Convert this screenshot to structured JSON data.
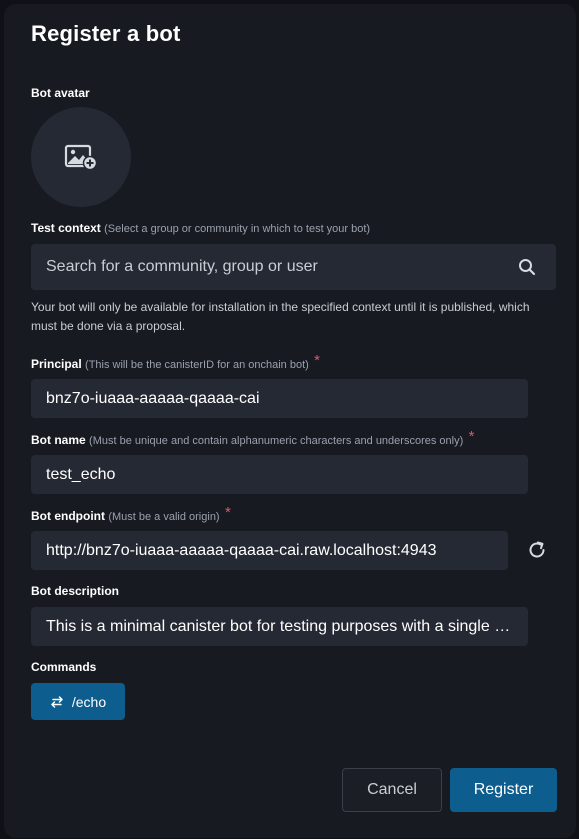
{
  "dialog": {
    "title": "Register a bot"
  },
  "avatar": {
    "label": "Bot avatar",
    "icon": "add-image-icon"
  },
  "test_context": {
    "label": "Test context",
    "hint": "(Select a group or community in which to test your bot)",
    "placeholder": "Search for a community, group or user",
    "icon": "search-icon",
    "note": "Your bot will only be available for installation in the specified context until it is published, which must be done via a proposal."
  },
  "principal": {
    "label": "Principal",
    "hint": "(This will be the canisterID for an onchain bot)",
    "required": "*",
    "value": "bnz7o-iuaaa-aaaaa-qaaaa-cai"
  },
  "bot_name": {
    "label": "Bot name",
    "hint": "(Must be unique and contain alphanumeric characters and underscores only)",
    "required": "*",
    "value": "test_echo"
  },
  "endpoint": {
    "label": "Bot endpoint",
    "hint": "(Must be a valid origin)",
    "required": "*",
    "value": "http://bnz7o-iuaaa-aaaaa-qaaaa-cai.raw.localhost:4943",
    "refresh_icon": "refresh-icon"
  },
  "description": {
    "label": "Bot description",
    "value": "This is a minimal canister bot for testing purposes with a single 'echo' command"
  },
  "commands": {
    "label": "Commands",
    "items": [
      {
        "label": "/echo",
        "icon": "swap-arrows-icon"
      }
    ]
  },
  "actions": {
    "cancel_label": "Cancel",
    "register_label": "Register"
  },
  "colors": {
    "background": "#171a21",
    "field": "#252934",
    "accent": "#0d5d8e",
    "required": "#e0566f"
  }
}
